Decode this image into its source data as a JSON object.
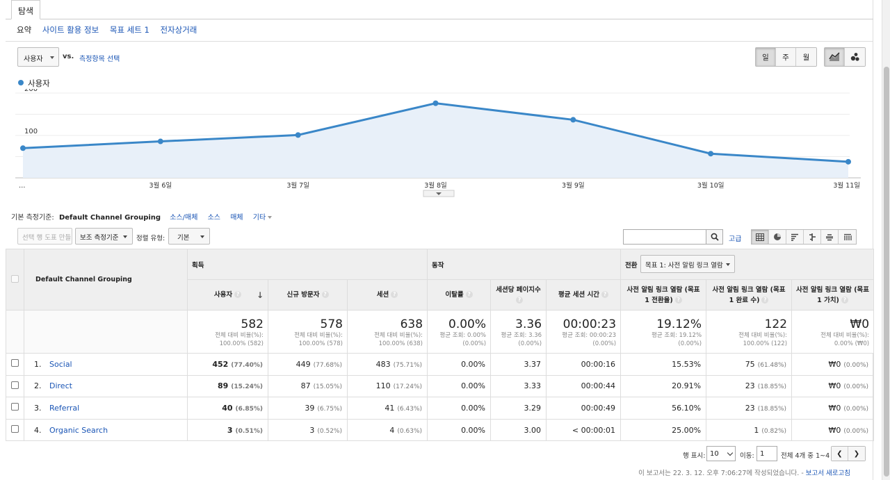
{
  "tab": "탐색",
  "subnav": [
    "요약",
    "사이트 활용 정보",
    "목표 세트 1",
    "전자상거래"
  ],
  "metric_select": "사용자",
  "vs_label": "vs.",
  "vs_link": "측정항목 선택",
  "period_buttons": [
    "일",
    "주",
    "월"
  ],
  "chart_legend": "사용자",
  "chart_data": {
    "type": "area",
    "title": "",
    "series": [
      {
        "name": "사용자",
        "values": [
          70,
          86,
          101,
          176,
          137,
          57,
          38
        ]
      }
    ],
    "x": [
      "…",
      "3월 6일",
      "3월 7일",
      "3월 8일",
      "3월 9일",
      "3월 10일",
      "3월 11일"
    ],
    "y_ticks": [
      100,
      200
    ],
    "ylim": [
      0,
      200
    ],
    "color": "#3a87c8",
    "grid": true
  },
  "dimension": {
    "label": "기본 측정기준:",
    "current": "Default Channel Grouping",
    "links": [
      "소스/매체",
      "소스",
      "매체"
    ],
    "more": "기타"
  },
  "toolbar": {
    "plot_rows": "선택 행 도표 만들기",
    "secondary": "보조 측정기준",
    "sort_label": "정렬 유형:",
    "sort_value": "기본",
    "advanced": "고급"
  },
  "table": {
    "dim_header": "Default Channel Grouping",
    "groups": [
      "획득",
      "동작",
      "전환"
    ],
    "conversion_select": "목표 1: 사전 알림 링크 열람",
    "columns": [
      "사용자",
      "신규 방문자",
      "세션",
      "이탈률",
      "세션당 페이지수",
      "평균 세션 시간",
      "사전 알림 링크 열람 (목표 1 전환율)",
      "사전 알림 링크 열람 (목표 1 완료 수)",
      "사전 알림 링크 열람 (목표 1 가치)"
    ],
    "totals": [
      {
        "v": "582",
        "s1": "전체 대비 비율(%):",
        "s2": "100.00% (582)"
      },
      {
        "v": "578",
        "s1": "전체 대비 비율(%):",
        "s2": "100.00% (578)"
      },
      {
        "v": "638",
        "s1": "전체 대비 비율(%):",
        "s2": "100.00% (638)"
      },
      {
        "v": "0.00%",
        "s1": "평균 조회: 0.00%",
        "s2": "(0.00%)"
      },
      {
        "v": "3.36",
        "s1": "평균 조회: 3.36",
        "s2": "(0.00%)"
      },
      {
        "v": "00:00:23",
        "s1": "평균 조회: 00:00:23",
        "s2": "(0.00%)"
      },
      {
        "v": "19.12%",
        "s1": "평균 조회: 19.12%",
        "s2": "(0.00%)"
      },
      {
        "v": "122",
        "s1": "전체 대비 비율(%):",
        "s2": "100.00% (122)"
      },
      {
        "v": "₩0",
        "s1": "전체 대비 비율(%):",
        "s2": "0.00% (₩0)"
      }
    ],
    "rows": [
      {
        "num": "1.",
        "name": "Social",
        "users": "452",
        "users_pct": "(77.40%)",
        "new": "449",
        "new_pct": "(77.68%)",
        "sessions": "483",
        "sessions_pct": "(75.71%)",
        "bounce": "0.00%",
        "pps": "3.37",
        "dur": "00:00:16",
        "conv": "15.53%",
        "done": "75",
        "done_pct": "(61.48%)",
        "val": "₩0",
        "val_pct": "(0.00%)"
      },
      {
        "num": "2.",
        "name": "Direct",
        "users": "89",
        "users_pct": "(15.24%)",
        "new": "87",
        "new_pct": "(15.05%)",
        "sessions": "110",
        "sessions_pct": "(17.24%)",
        "bounce": "0.00%",
        "pps": "3.33",
        "dur": "00:00:44",
        "conv": "20.91%",
        "done": "23",
        "done_pct": "(18.85%)",
        "val": "₩0",
        "val_pct": "(0.00%)"
      },
      {
        "num": "3.",
        "name": "Referral",
        "users": "40",
        "users_pct": "(6.85%)",
        "new": "39",
        "new_pct": "(6.75%)",
        "sessions": "41",
        "sessions_pct": "(6.43%)",
        "bounce": "0.00%",
        "pps": "3.29",
        "dur": "00:00:49",
        "conv": "56.10%",
        "done": "23",
        "done_pct": "(18.85%)",
        "val": "₩0",
        "val_pct": "(0.00%)"
      },
      {
        "num": "4.",
        "name": "Organic Search",
        "users": "3",
        "users_pct": "(0.51%)",
        "new": "3",
        "new_pct": "(0.52%)",
        "sessions": "4",
        "sessions_pct": "(0.63%)",
        "bounce": "0.00%",
        "pps": "3.00",
        "dur": "< 00:00:01",
        "conv": "25.00%",
        "done": "1",
        "done_pct": "(0.82%)",
        "val": "₩0",
        "val_pct": "(0.00%)"
      }
    ]
  },
  "pager": {
    "show_label": "행 표시:",
    "show_value": "10",
    "goto_label": "이동:",
    "goto_value": "1",
    "range": "전체 4개 중 1~4"
  },
  "footer": {
    "text": "이 보고서는 22. 3. 12. 오후 7:06:27에 작성되었습니다. - ",
    "link": "보고서 새로고침"
  }
}
